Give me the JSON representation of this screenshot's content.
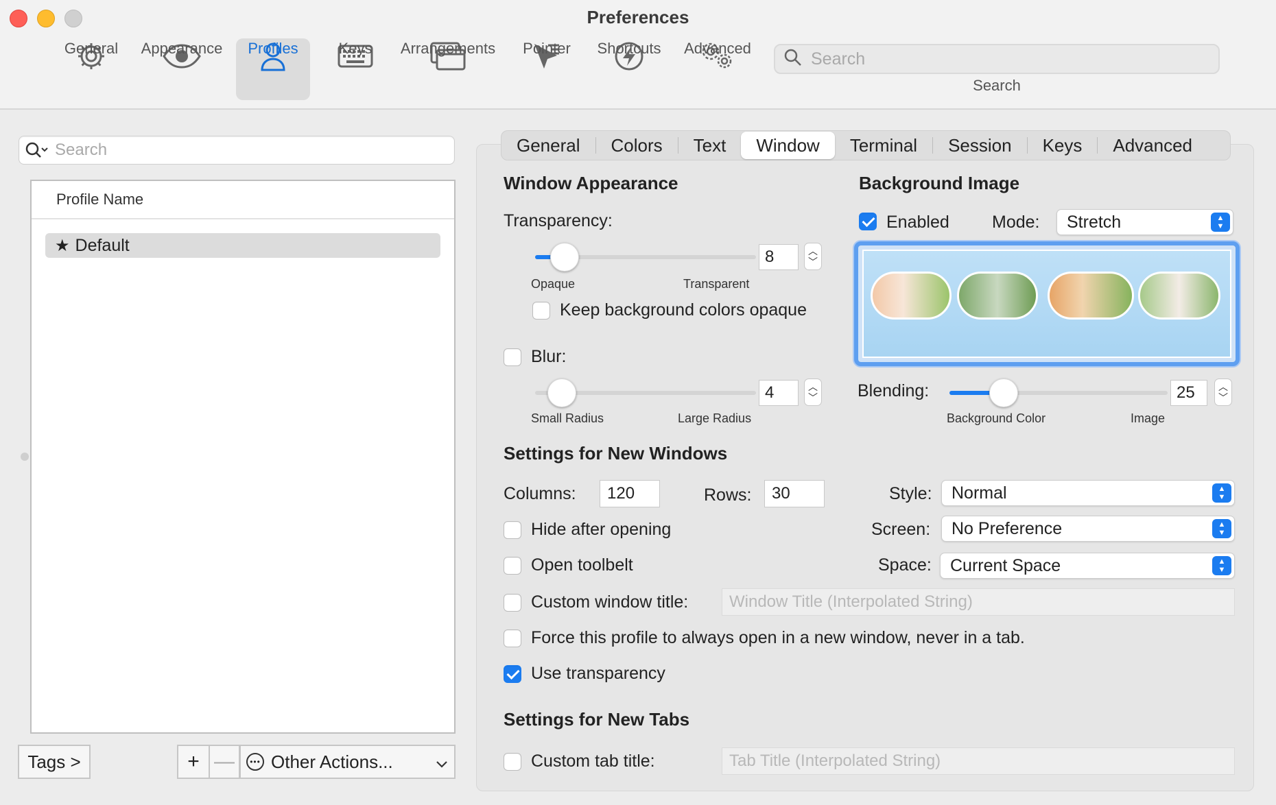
{
  "window": {
    "title": "Preferences"
  },
  "toolbar": {
    "items": [
      {
        "label": "General",
        "icon": "gear-icon",
        "active": false
      },
      {
        "label": "Appearance",
        "icon": "eye-icon",
        "active": false
      },
      {
        "label": "Profiles",
        "icon": "person-icon",
        "active": true
      },
      {
        "label": "Keys",
        "icon": "keyboard-icon",
        "active": false
      },
      {
        "label": "Arrangements",
        "icon": "windows-icon",
        "active": false
      },
      {
        "label": "Pointer",
        "icon": "pointer-icon",
        "active": false
      },
      {
        "label": "Shortcuts",
        "icon": "lightning-icon",
        "active": false
      },
      {
        "label": "Advanced",
        "icon": "gears-icon",
        "active": false
      }
    ],
    "search": {
      "placeholder": "Search",
      "label": "Search"
    },
    "active_color": "#1870d6"
  },
  "profiles": {
    "search_placeholder": "Search",
    "column_header": "Profile Name",
    "rows": [
      {
        "name": "Default",
        "icon": "star-icon"
      }
    ],
    "buttons": {
      "tags": "Tags >",
      "add": "+",
      "remove": "—",
      "other_actions": "Other Actions..."
    }
  },
  "tabs": {
    "items": [
      "General",
      "Colors",
      "Text",
      "Window",
      "Terminal",
      "Session",
      "Keys",
      "Advanced"
    ],
    "active": "Window"
  },
  "window_appearance": {
    "title": "Window Appearance",
    "transparency": {
      "label": "Transparency:",
      "value": "8",
      "min_label": "Opaque",
      "max_label": "Transparent",
      "fraction": 0.13
    },
    "keep_bg_opaque": {
      "label": "Keep background colors opaque",
      "checked": false
    },
    "blur": {
      "label": "Blur:",
      "checked": false,
      "value": "4",
      "min_label": "Small Radius",
      "max_label": "Large Radius",
      "fraction": 0.12
    }
  },
  "background_image": {
    "title": "Background Image",
    "enabled": {
      "label": "Enabled",
      "checked": true
    },
    "mode": {
      "label": "Mode:",
      "value": "Stretch"
    },
    "blending": {
      "label": "Blending:",
      "value": "25",
      "min_label": "Background Color",
      "max_label": "Image",
      "fraction": 0.25
    }
  },
  "new_windows": {
    "title": "Settings for New Windows",
    "columns": {
      "label": "Columns:",
      "value": "120"
    },
    "rows": {
      "label": "Rows:",
      "value": "30"
    },
    "style": {
      "label": "Style:",
      "value": "Normal"
    },
    "screen": {
      "label": "Screen:",
      "value": "No Preference"
    },
    "space": {
      "label": "Space:",
      "value": "Current Space"
    },
    "hide_after_opening": {
      "label": "Hide after opening",
      "checked": false
    },
    "open_toolbelt": {
      "label": "Open toolbelt",
      "checked": false
    },
    "custom_window_title": {
      "label": "Custom window title:",
      "placeholder": "Window Title (Interpolated String)",
      "checked": false
    },
    "force_new_window": {
      "label": "Force this profile to always open in a new window, never in a tab.",
      "checked": false
    },
    "use_transparency": {
      "label": "Use transparency",
      "checked": true
    }
  },
  "new_tabs": {
    "title": "Settings for New Tabs",
    "custom_tab_title": {
      "label": "Custom tab title:",
      "placeholder": "Tab Title (Interpolated String)",
      "checked": false
    }
  },
  "colors": {
    "accent": "#1b7cf0",
    "close": "#fe5f57",
    "minimize": "#febc2e",
    "zoom": "#d0d0d0"
  }
}
